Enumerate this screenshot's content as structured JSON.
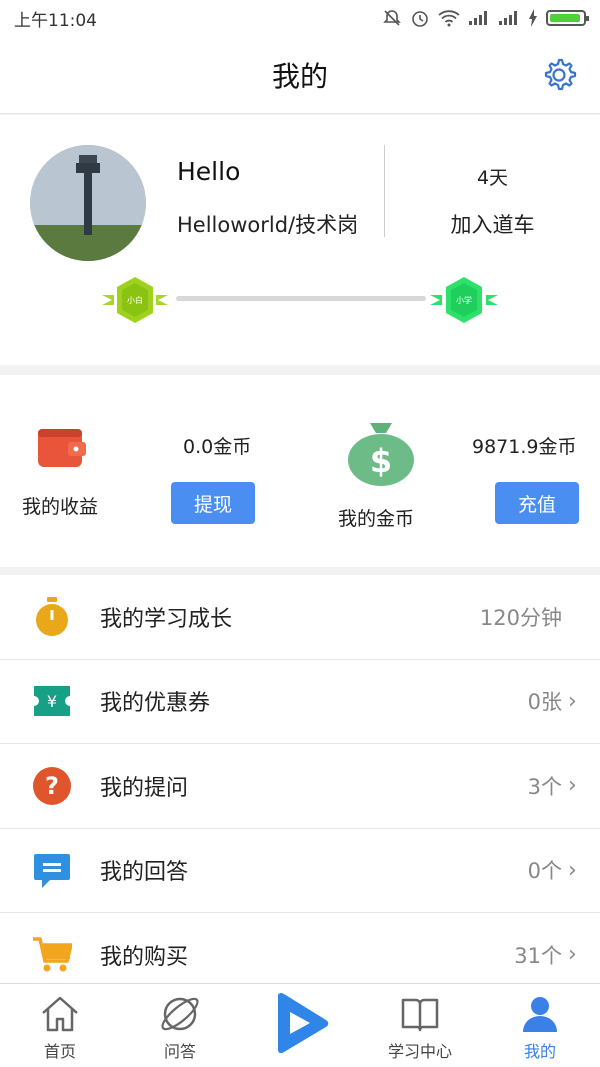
{
  "status_bar": {
    "time": "上午11:04"
  },
  "header": {
    "title": "我的"
  },
  "profile": {
    "name": "Hello",
    "role": "Helloworld/技术岗",
    "days": "4天",
    "join_label": "加入道车",
    "level_left": "小白",
    "level_right": "小学",
    "level_progress": 0
  },
  "wallet": {
    "income_label": "我的收益",
    "income_value": "0.0金币",
    "withdraw_label": "提现",
    "coins_label": "我的金币",
    "coins_value": "9871.9金币",
    "recharge_label": "充值"
  },
  "menu": [
    {
      "label": "我的学习成长",
      "value": "120分钟",
      "chevron": false,
      "icon": "stopwatch-icon",
      "color": "#e9a71a"
    },
    {
      "label": "我的优惠券",
      "value": "0张",
      "chevron": true,
      "icon": "coupon-icon",
      "color": "#16a085"
    },
    {
      "label": "我的提问",
      "value": "3个",
      "chevron": true,
      "icon": "question-icon",
      "color": "#e0552c"
    },
    {
      "label": "我的回答",
      "value": "0个",
      "chevron": true,
      "icon": "chat-icon",
      "color": "#2f8fe0"
    },
    {
      "label": "我的购买",
      "value": "31个",
      "chevron": true,
      "icon": "cart-icon",
      "color": "#f2a51e"
    }
  ],
  "tabs": [
    {
      "label": "首页",
      "icon": "home-icon"
    },
    {
      "label": "问答",
      "icon": "planet-icon"
    },
    {
      "label": "",
      "icon": "play-icon"
    },
    {
      "label": "学习中心",
      "icon": "book-icon"
    },
    {
      "label": "我的",
      "icon": "person-icon",
      "active": true
    }
  ],
  "colors": {
    "accent": "#4b8ef1",
    "active_tab": "#3a80e6"
  }
}
